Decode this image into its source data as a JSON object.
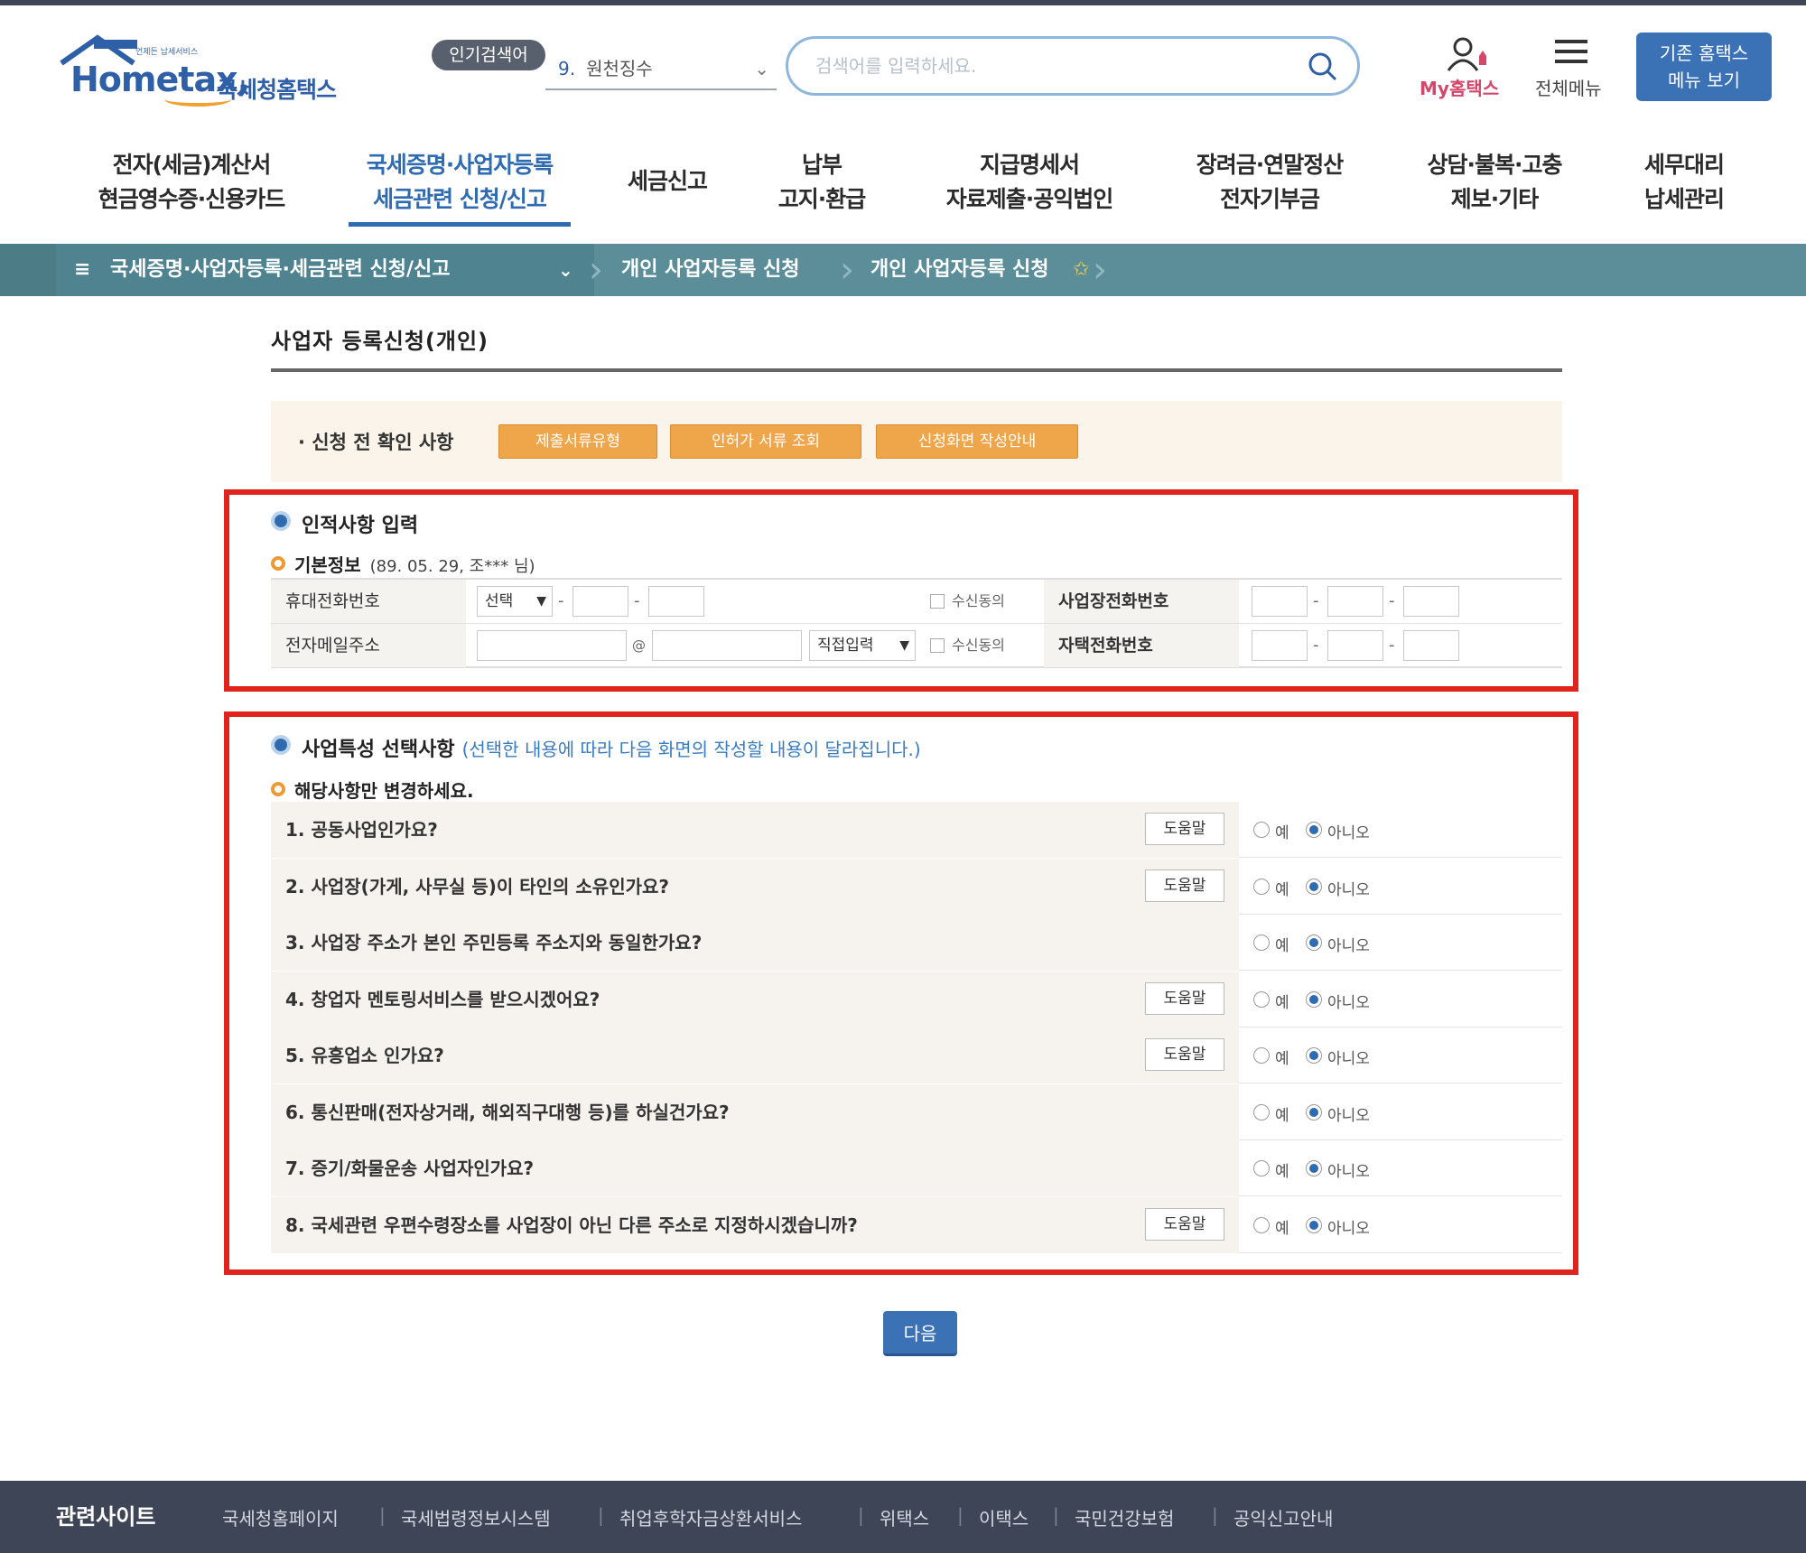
{
  "header": {
    "logo_small": "언제든 납세서비스",
    "logo_main": "Hometax,",
    "logo_ko": "국세청홈택스",
    "popular_badge": "인기검색어",
    "popular_rank": "9.",
    "popular_term": "원천징수",
    "search_placeholder": "검색어를 입력하세요.",
    "my_label": "My홈택스",
    "all_menu_label": "전체메뉴",
    "old_menu_btn": [
      "기존 홈택스",
      "메뉴 보기"
    ]
  },
  "gnb": [
    {
      "line1": "전자(세금)계산서",
      "line2": "현금영수증·신용카드"
    },
    {
      "line1": "국세증명·사업자등록",
      "line2": "세금관련 신청/신고",
      "active": true
    },
    {
      "line1": "세금신고",
      "line2": ""
    },
    {
      "line1": "납부",
      "line2": "고지·환급"
    },
    {
      "line1": "지급명세서",
      "line2": "자료제출·공익법인"
    },
    {
      "line1": "장려금·연말정산",
      "line2": "전자기부금"
    },
    {
      "line1": "상담·불복·고충",
      "line2": "제보·기타"
    },
    {
      "line1": "세무대리",
      "line2": "납세관리"
    }
  ],
  "breadcrumb": {
    "menu_icon": "≡",
    "first": "국세증명·사업자등록·세금관련 신청/신고",
    "second": "개인 사업자등록 신청",
    "third": "개인 사업자등록 신청",
    "star": "✩"
  },
  "page": {
    "title": "사업자 등록신청(개인)",
    "check_label": "· 신청 전 확인 사항",
    "buttons": [
      "제출서류유형",
      "인허가 서류 조회",
      "신청화면 작성안내"
    ]
  },
  "personal": {
    "heading": "인적사항 입력",
    "basic_label": "기본정보",
    "basic_note": "(89. 05. 29, 조*** 님)",
    "mobile_label": "휴대전화번호",
    "mobile_select": "선택",
    "consent": "수신동의",
    "biz_phone_label": "사업장전화번호",
    "email_label": "전자메일주소",
    "at": "@",
    "email_select": "직접입력",
    "home_phone_label": "자택전화번호",
    "dash": "-"
  },
  "traits": {
    "heading": "사업특성 선택사항",
    "note": "(선택한 내용에 따라 다음 화면의 작성할 내용이 달라집니다.)",
    "sub": "해당사항만 변경하세요.",
    "help_label": "도움말",
    "yes": "예",
    "no": "아니오",
    "questions": [
      {
        "text": "1. 공동사업인가요?",
        "help": true,
        "answer": "no"
      },
      {
        "text": "2. 사업장(가게, 사무실 등)이 타인의 소유인가요?",
        "help": true,
        "answer": "no"
      },
      {
        "text": "3. 사업장 주소가 본인 주민등록 주소지와 동일한가요?",
        "help": false,
        "answer": "no"
      },
      {
        "text": "4. 창업자 멘토링서비스를 받으시겠어요?",
        "help": true,
        "answer": "no"
      },
      {
        "text": "5. 유흥업소 인가요?",
        "help": true,
        "answer": "no"
      },
      {
        "text": "6. 통신판매(전자상거래, 해외직구대행 등)를 하실건가요?",
        "help": false,
        "answer": "no"
      },
      {
        "text": "7. 증기/화물운송 사업자인가요?",
        "help": false,
        "answer": "no"
      },
      {
        "text": "8. 국세관련 우편수령장소를 사업장이 아닌 다른 주소로 지정하시겠습니까?",
        "help": true,
        "answer": "no"
      }
    ]
  },
  "next_button": "다음",
  "footer": {
    "title": "관련사이트",
    "links": [
      "국세청홈페이지",
      "국세법령정보시스템",
      "취업후학자금상환서비스",
      "위택스",
      "이택스",
      "국민건강보험",
      "공익신고안내"
    ]
  },
  "colors": {
    "accent": "#2e6bb0",
    "breadcrumb": "#5b8e98",
    "highlight": "#e0241d",
    "orange": "#efa54a",
    "footer": "#3e4556"
  }
}
